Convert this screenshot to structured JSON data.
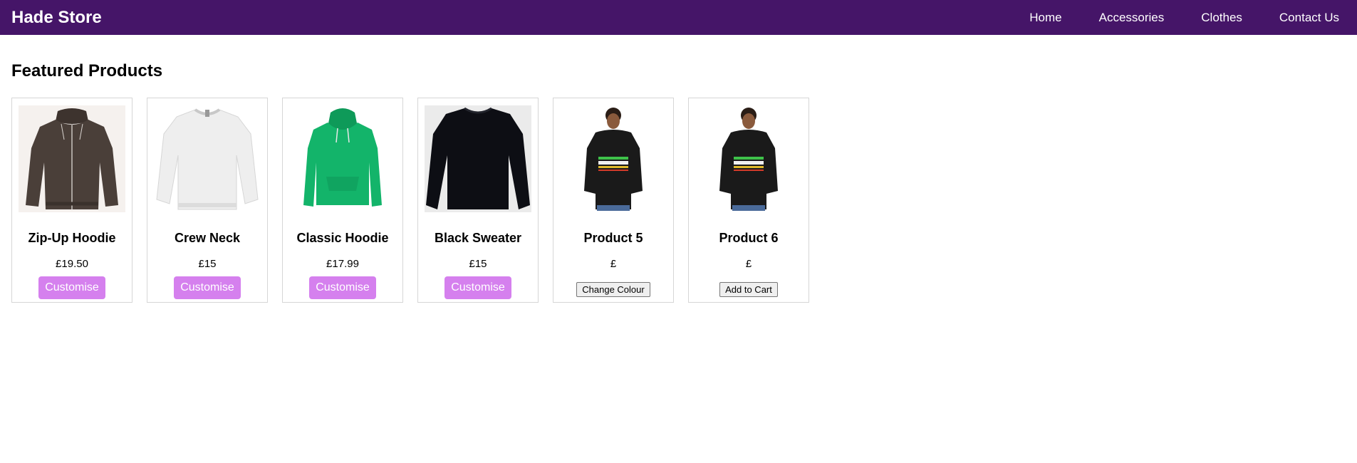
{
  "header": {
    "brand": "Hade Store",
    "nav": [
      {
        "label": "Home"
      },
      {
        "label": "Accessories"
      },
      {
        "label": "Clothes"
      },
      {
        "label": "Contact Us"
      }
    ]
  },
  "main": {
    "section_title": "Featured Products",
    "products": [
      {
        "name": "Zip-Up Hoodie",
        "price": "£19.50",
        "button": "Customise",
        "image_icon": "brown-zip-hoodie-icon",
        "color": "#4a3f39"
      },
      {
        "name": "Crew Neck",
        "price": "£15",
        "button": "Customise",
        "image_icon": "white-sweatshirt-icon",
        "color": "#f0f0f0"
      },
      {
        "name": "Classic Hoodie",
        "price": "£17.99",
        "button": "Customise",
        "image_icon": "green-hoodie-icon",
        "color": "#13b46a"
      },
      {
        "name": "Black Sweater",
        "price": "£15",
        "button": "Customise",
        "image_icon": "black-sweater-icon",
        "color": "#0d0e14"
      },
      {
        "name": "Product 5",
        "price": "£",
        "button": "Change Colour",
        "image_icon": "model-black-hoodie-icon",
        "color": "#1a1a1a"
      },
      {
        "name": "Product 6",
        "price": "£",
        "button": "Add to Cart",
        "image_icon": "model-black-hoodie-icon",
        "color": "#1a1a1a"
      }
    ]
  },
  "colors": {
    "navbar": "#451568",
    "customise_button": "#d580ee"
  }
}
